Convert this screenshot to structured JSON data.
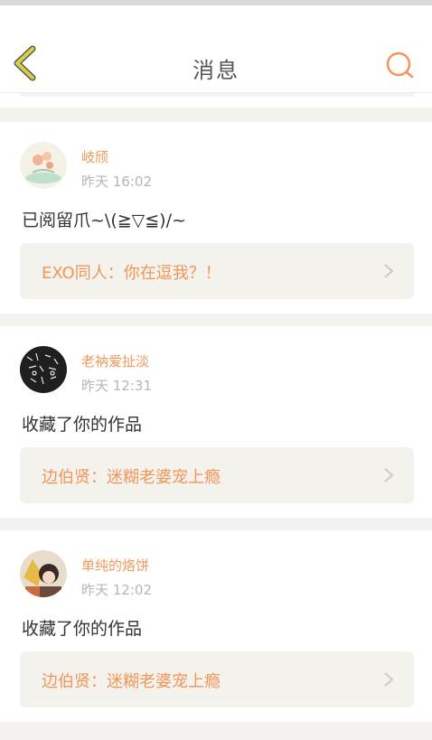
{
  "header": {
    "title": "消息",
    "back_icon": "chevron-left-icon",
    "search_icon": "search-icon",
    "accent_color": "#f29559",
    "back_color": "#d9d041"
  },
  "messages": [
    {
      "user": "岐颀",
      "time": "昨天 16:02",
      "text": "已阅留爪~\\(≧▽≦)/~",
      "quote": "EXO同人：你在逗我？！"
    },
    {
      "user": "老衲爱扯淡",
      "time": "昨天 12:31",
      "text": "收藏了你的作品",
      "quote": "边伯贤：迷糊老婆宠上瘾"
    },
    {
      "user": "单纯的烙饼",
      "time": "昨天 12:02",
      "text": "收藏了你的作品",
      "quote": "边伯贤：迷糊老婆宠上瘾"
    }
  ]
}
